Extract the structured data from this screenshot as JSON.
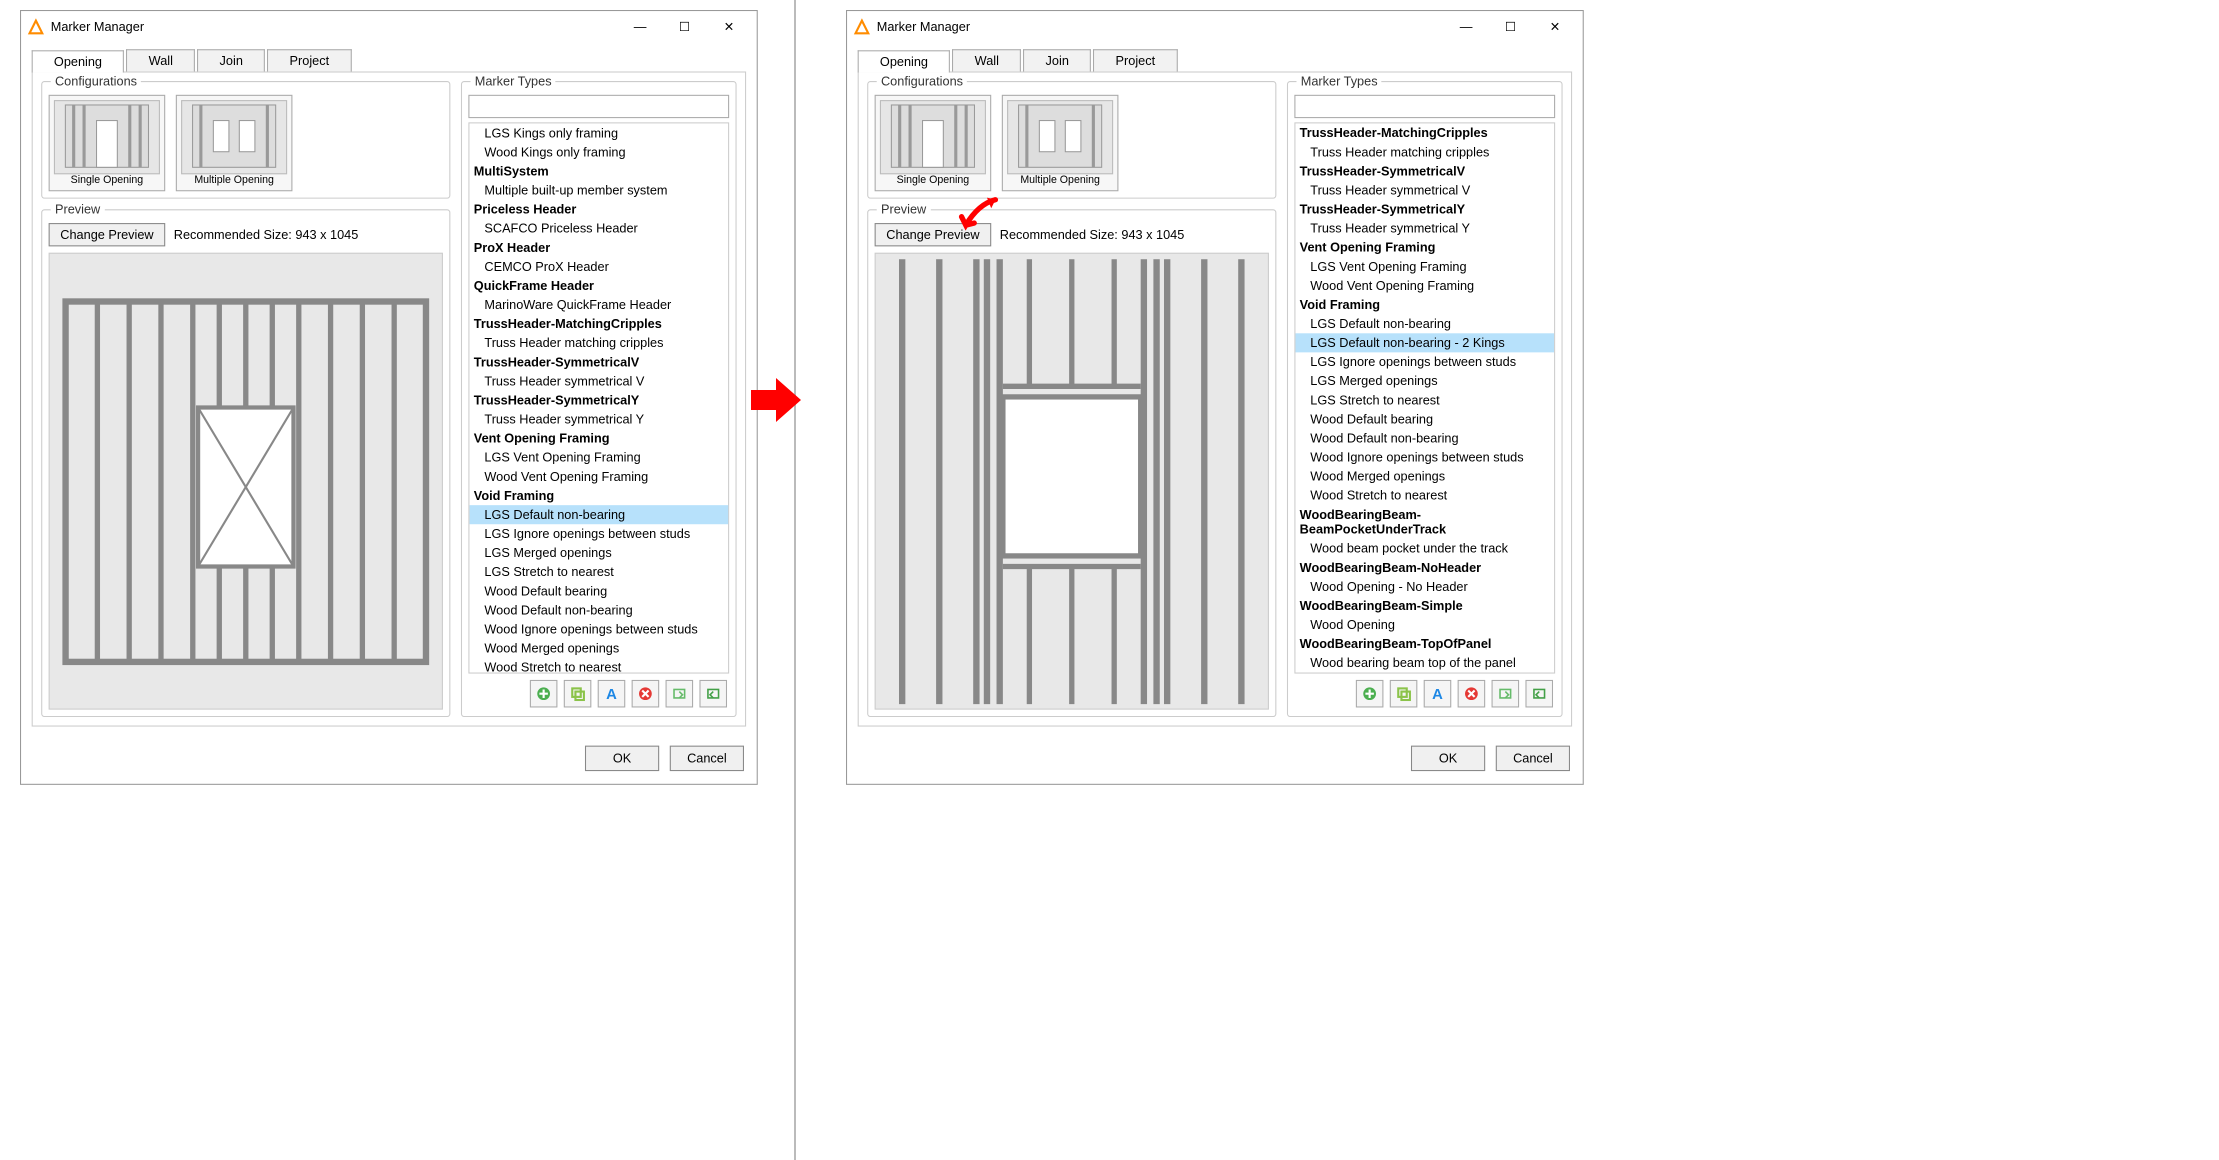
{
  "window_title": "Marker Manager",
  "tabs": [
    "Opening",
    "Wall",
    "Join",
    "Project"
  ],
  "active_tab": "Opening",
  "configurations": {
    "label": "Configurations",
    "items": [
      {
        "label": "Single Opening"
      },
      {
        "label": "Multiple Opening"
      }
    ]
  },
  "preview": {
    "label": "Preview",
    "change_btn": "Change Preview",
    "recommended": "Recommended Size: 943 x 1045"
  },
  "marker_types_label": "Marker Types",
  "buttons": {
    "ok": "OK",
    "cancel": "Cancel"
  },
  "left": {
    "selected": "LGS Default non-bearing",
    "list": [
      {
        "t": "itm",
        "v": "LGS Kings only framing"
      },
      {
        "t": "itm",
        "v": "Wood Kings only framing"
      },
      {
        "t": "hdr",
        "v": "MultiSystem"
      },
      {
        "t": "itm",
        "v": "Multiple built-up member system"
      },
      {
        "t": "hdr",
        "v": "Priceless Header"
      },
      {
        "t": "itm",
        "v": "SCAFCO Priceless Header"
      },
      {
        "t": "hdr",
        "v": "ProX Header"
      },
      {
        "t": "itm",
        "v": "CEMCO ProX Header"
      },
      {
        "t": "hdr",
        "v": "QuickFrame Header"
      },
      {
        "t": "itm",
        "v": "MarinoWare QuickFrame Header"
      },
      {
        "t": "hdr",
        "v": "TrussHeader-MatchingCripples"
      },
      {
        "t": "itm",
        "v": "Truss Header matching cripples"
      },
      {
        "t": "hdr",
        "v": "TrussHeader-SymmetricalV"
      },
      {
        "t": "itm",
        "v": "Truss Header symmetrical V"
      },
      {
        "t": "hdr",
        "v": "TrussHeader-SymmetricalY"
      },
      {
        "t": "itm",
        "v": "Truss Header symmetrical Y"
      },
      {
        "t": "hdr",
        "v": "Vent Opening Framing"
      },
      {
        "t": "itm",
        "v": "LGS Vent Opening Framing"
      },
      {
        "t": "itm",
        "v": "Wood Vent Opening Framing"
      },
      {
        "t": "hdr",
        "v": "Void Framing"
      },
      {
        "t": "itm",
        "v": "LGS Default non-bearing"
      },
      {
        "t": "itm",
        "v": "LGS Ignore openings between studs"
      },
      {
        "t": "itm",
        "v": "LGS Merged openings"
      },
      {
        "t": "itm",
        "v": "LGS Stretch to nearest"
      },
      {
        "t": "itm",
        "v": "Wood Default bearing"
      },
      {
        "t": "itm",
        "v": "Wood Default non-bearing"
      },
      {
        "t": "itm",
        "v": "Wood Ignore openings between studs"
      },
      {
        "t": "itm",
        "v": "Wood Merged openings"
      },
      {
        "t": "itm",
        "v": "Wood Stretch to nearest"
      }
    ]
  },
  "right": {
    "selected": "LGS Default non-bearing - 2 Kings",
    "list": [
      {
        "t": "hdr",
        "v": "TrussHeader-MatchingCripples"
      },
      {
        "t": "itm",
        "v": "Truss Header matching cripples"
      },
      {
        "t": "hdr",
        "v": "TrussHeader-SymmetricalV"
      },
      {
        "t": "itm",
        "v": "Truss Header symmetrical V"
      },
      {
        "t": "hdr",
        "v": "TrussHeader-SymmetricalY"
      },
      {
        "t": "itm",
        "v": "Truss Header symmetrical Y"
      },
      {
        "t": "hdr",
        "v": "Vent Opening Framing"
      },
      {
        "t": "itm",
        "v": "LGS Vent Opening Framing"
      },
      {
        "t": "itm",
        "v": "Wood Vent Opening Framing"
      },
      {
        "t": "hdr",
        "v": "Void Framing"
      },
      {
        "t": "itm",
        "v": "LGS Default non-bearing"
      },
      {
        "t": "itm",
        "v": "LGS Default non-bearing - 2 Kings"
      },
      {
        "t": "itm",
        "v": "LGS Ignore openings between studs"
      },
      {
        "t": "itm",
        "v": "LGS Merged openings"
      },
      {
        "t": "itm",
        "v": "LGS Stretch to nearest"
      },
      {
        "t": "itm",
        "v": "Wood Default bearing"
      },
      {
        "t": "itm",
        "v": "Wood Default non-bearing"
      },
      {
        "t": "itm",
        "v": "Wood Ignore openings between studs"
      },
      {
        "t": "itm",
        "v": "Wood Merged openings"
      },
      {
        "t": "itm",
        "v": "Wood Stretch to nearest"
      },
      {
        "t": "hdr",
        "v": "WoodBearingBeam-BeamPocketUnderTrack"
      },
      {
        "t": "itm",
        "v": "Wood beam pocket under the track"
      },
      {
        "t": "hdr",
        "v": "WoodBearingBeam-NoHeader"
      },
      {
        "t": "itm",
        "v": "Wood Opening - No Header"
      },
      {
        "t": "hdr",
        "v": "WoodBearingBeam-Simple"
      },
      {
        "t": "itm",
        "v": "Wood Opening"
      },
      {
        "t": "hdr",
        "v": "WoodBearingBeam-TopOfPanel"
      },
      {
        "t": "itm",
        "v": "Wood bearing beam top of the panel"
      }
    ]
  },
  "toolbar_icons": [
    "add-icon",
    "copy-icon",
    "text-icon",
    "delete-icon",
    "export-icon",
    "import-icon"
  ],
  "toolbar_colors": [
    "#4caf50",
    "#8bc34a",
    "#1e88e5",
    "#e53935",
    "#66bb6a",
    "#43a047"
  ]
}
